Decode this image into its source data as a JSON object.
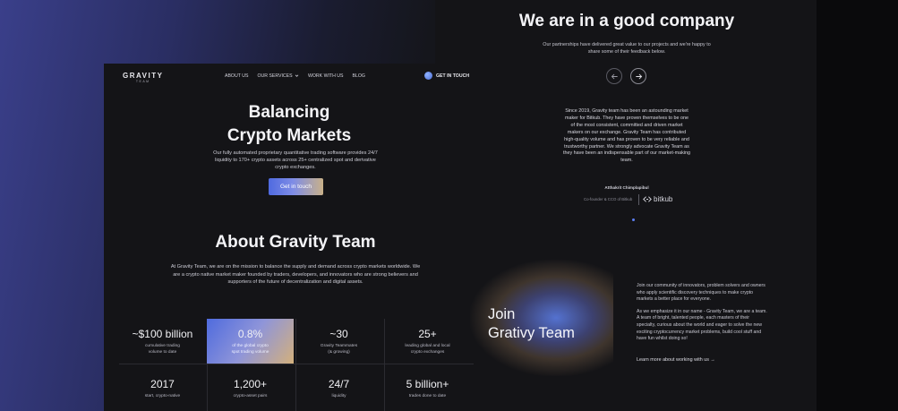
{
  "nav": {
    "logo_main": "GRAVITY",
    "logo_sub": "TEAM",
    "items": [
      {
        "label": "ABOUT US"
      },
      {
        "label": "OUR SERVICES"
      },
      {
        "label": "WORK WITH US"
      },
      {
        "label": "BLOG"
      }
    ],
    "cta_label": "GET IN TOUCH",
    "icons": {
      "services_dropdown": "chevron-down-icon",
      "cta": "circle-dot-icon"
    }
  },
  "hero": {
    "title_line1": "Balancing",
    "title_line2": "Crypto Markets",
    "description": "Our fully automated proprietary quantitative trading software provides 24/7 liquidity to 170+ crypto assets across 25+ centralized spot and derivative crypto exchanges.",
    "button_label": "Get in touch"
  },
  "about": {
    "title": "About Gravity Team",
    "description": "At Gravity Team, we are on the mission to balance the supply and demand across crypto markets worldwide. We are a crypto native market maker founded by traders, developers, and innovators who are strong believers and supporters of the future of decentralization and digital assets."
  },
  "stats": [
    {
      "value": "~$100 billion",
      "label": "cumulative trading volume to date"
    },
    {
      "value": "0.8%",
      "label": "of the global crypto spot trading volume"
    },
    {
      "value": "~30",
      "label": "Gravity Teammates (& growing)"
    },
    {
      "value": "25+",
      "label": "leading global and local crypto exchanges"
    },
    {
      "value": "2017",
      "label": "start, crypto-native"
    },
    {
      "value": "1,200+",
      "label": "crypto-asset pairs"
    },
    {
      "value": "24/7",
      "label": "liquidity"
    },
    {
      "value": "5 billion+",
      "label": "trades done to date"
    }
  ],
  "company": {
    "title": "We are in a good company",
    "description": "Our partnerships have delivered great value to our projects and we're happy to share some of their feedback below.",
    "quote": "Since 2019, Gravity team has been an astounding market maker for Bitkub. They have proven themselves to be one of the most consistent, committed and driven market makers on our exchange. Gravity Team has contributed high-quality volume and has proven to be very reliable and trustworthy partner. We strongly advocate Gravity Team as they have been an indispensable part of our market-making team.",
    "author": "Atthakrit Chimplapibul",
    "author_role": "Co-founder & CCO of Bitkub",
    "brand": "bitkub",
    "icons": {
      "prev": "arrow-left-icon",
      "next": "arrow-right-icon",
      "brand": "bitkub-logo-icon"
    }
  },
  "join": {
    "title_line1": "Join",
    "title_line2": "Grativy Team",
    "paragraph1": "Join our community of innovators, problem solvers and owners who apply scientific discovery techniques to make crypto markets a better place for everyone.",
    "paragraph2": "As we emphasize it in our name - Gravity Team, we are a team. A team of bright, talented people, each masters of their specialty, curious about the world and eager to solve the new exciting cryptocurrency market problems, build cool stuff and have fun whilst doing so!",
    "link_label": "Learn more about working with us →"
  },
  "colors": {
    "accent_blue": "#4f6ae0",
    "accent_gold": "#c9b189",
    "panel_bg": "#141417"
  }
}
